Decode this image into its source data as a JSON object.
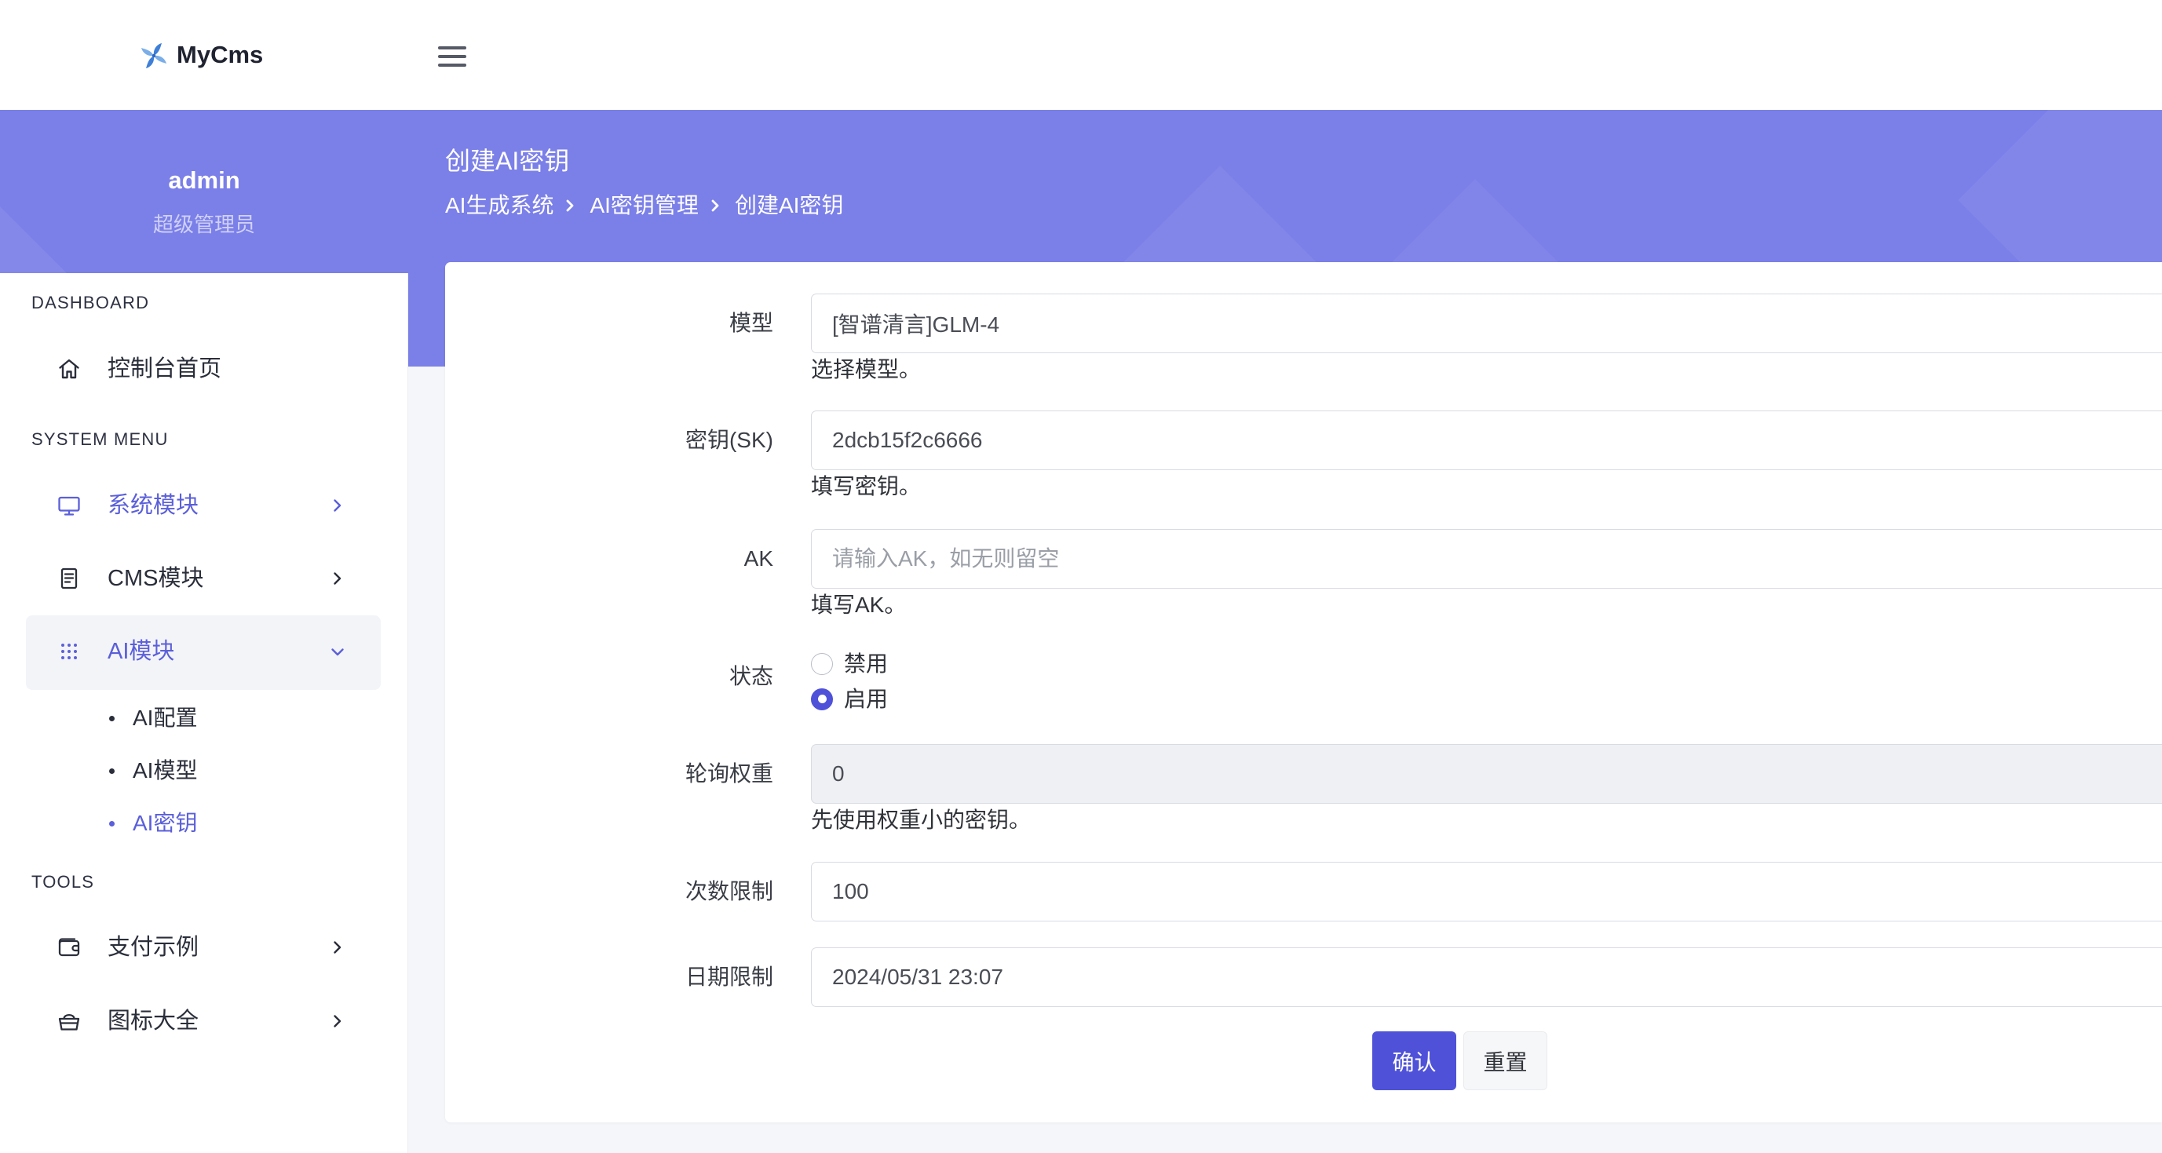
{
  "colors": {
    "banner": "#7b7fe8",
    "accent": "#5b5fd9",
    "primary_button": "#4f52d8",
    "page_bg": "#f5f6fa",
    "active_item_bg": "#f3f4f8"
  },
  "brand": {
    "name": "MyCms",
    "logo_icon": "pinwheel-logo-icon"
  },
  "header": {
    "menu_icon": "hamburger-menu-icon"
  },
  "user": {
    "name": "admin",
    "role": "超级管理员"
  },
  "sidebar": {
    "dashboard": {
      "title": "DASHBOARD",
      "items": [
        {
          "label": "控制台首页",
          "icon": "home-icon"
        }
      ]
    },
    "system_menu": {
      "title": "SYSTEM MENU",
      "items": [
        {
          "label": "系统模块",
          "icon": "monitor-icon",
          "highlighted": true,
          "expanded": false
        },
        {
          "label": "CMS模块",
          "icon": "document-icon",
          "highlighted": false,
          "expanded": false
        },
        {
          "label": "AI模块",
          "icon": "grid-icon",
          "highlighted": true,
          "expanded": true,
          "children": [
            {
              "label": "AI配置",
              "active": false
            },
            {
              "label": "AI模型",
              "active": false
            },
            {
              "label": "AI密钥",
              "active": true
            }
          ]
        }
      ]
    },
    "tools": {
      "title": "TOOLS",
      "items": [
        {
          "label": "支付示例",
          "icon": "wallet-icon",
          "expanded": false
        },
        {
          "label": "图标大全",
          "icon": "basket-icon",
          "expanded": false
        }
      ]
    }
  },
  "icons": {
    "expand": "chevron-right-icon",
    "collapse": "chevron-down-icon",
    "breadcrumb_separator": "chevron-right-icon"
  },
  "page": {
    "title": "创建AI密钥",
    "breadcrumb": [
      "AI生成系统",
      "AI密钥管理",
      "创建AI密钥"
    ]
  },
  "form": {
    "model": {
      "label": "模型",
      "value": "[智谱清言]GLM-4",
      "help": "选择模型。"
    },
    "secret_key": {
      "label": "密钥(SK)",
      "value": "2dcb15f2c6666",
      "help": "填写密钥。"
    },
    "access_key": {
      "label": "AK",
      "placeholder": "请输入AK，如无则留空",
      "help": "填写AK。"
    },
    "status": {
      "label": "状态",
      "options": [
        "禁用",
        "启用"
      ],
      "selected_index": 1
    },
    "weight": {
      "label": "轮询权重",
      "value": "0",
      "help": "先使用权重小的密钥。",
      "readonly": true
    },
    "count_limit": {
      "label": "次数限制",
      "value": "100"
    },
    "date_limit": {
      "label": "日期限制",
      "value": "2024/05/31 23:07"
    },
    "submit_label": "确认",
    "reset_label": "重置"
  }
}
